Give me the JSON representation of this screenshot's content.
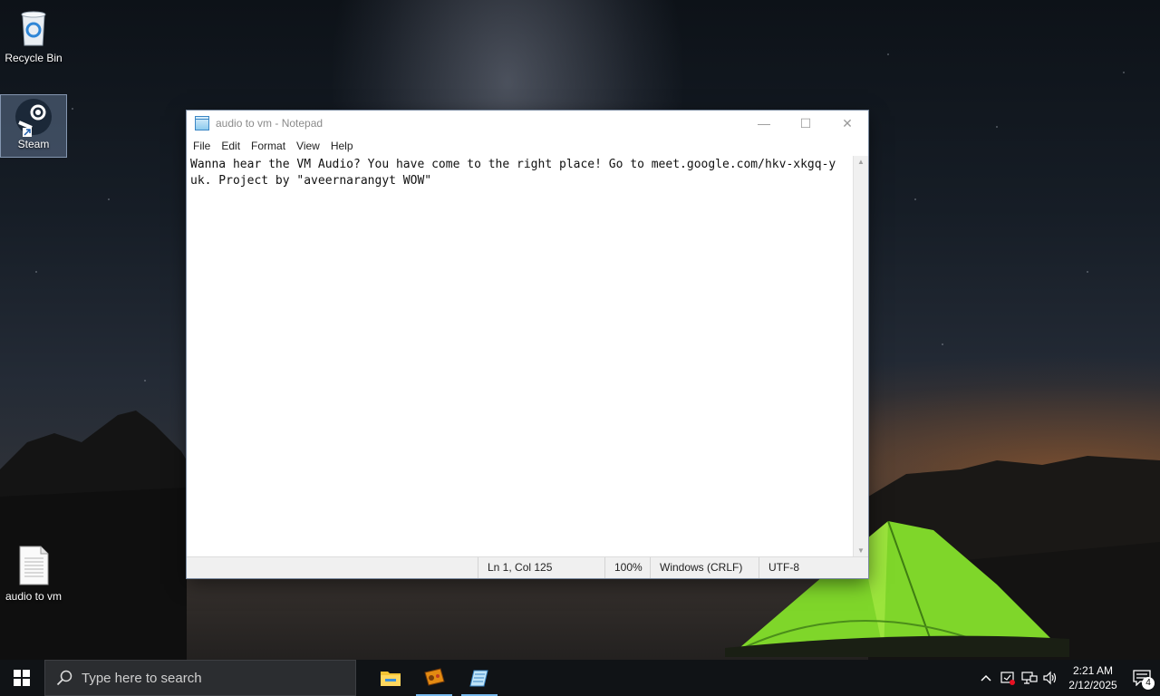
{
  "desktop": {
    "icons": [
      {
        "label": "Recycle Bin",
        "icon": "recycle-bin-icon"
      },
      {
        "label": "Steam",
        "icon": "steam-icon"
      },
      {
        "label": "audio to vm",
        "icon": "text-file-icon"
      }
    ]
  },
  "notepad": {
    "title": "audio to vm - Notepad",
    "controls": {
      "minimize": "—",
      "maximize": "☐",
      "close": "✕"
    },
    "menu": [
      "File",
      "Edit",
      "Format",
      "View",
      "Help"
    ],
    "content": "Wanna hear the VM Audio? You have come to the right place! Go to meet.google.com/hkv-xkgq-yuk. Project by \"aveernarangyt WOW\"",
    "status": {
      "position": "Ln 1, Col 125",
      "zoom": "100%",
      "line_ending": "Windows (CRLF)",
      "encoding": "UTF-8"
    }
  },
  "taskbar": {
    "search_placeholder": "Type here to search",
    "apps": [
      "file-explorer-icon",
      "gamepad-app-icon",
      "notepad-icon"
    ],
    "tray": [
      "chevron-up-icon",
      "security-icon",
      "network-icon",
      "volume-icon"
    ],
    "time": "2:21 AM",
    "date": "2/12/2025",
    "notification_count": "4"
  },
  "colors": {
    "taskbar_bg": "#101316",
    "accent": "#76b9ed",
    "tent_green": "#7fd62a"
  }
}
